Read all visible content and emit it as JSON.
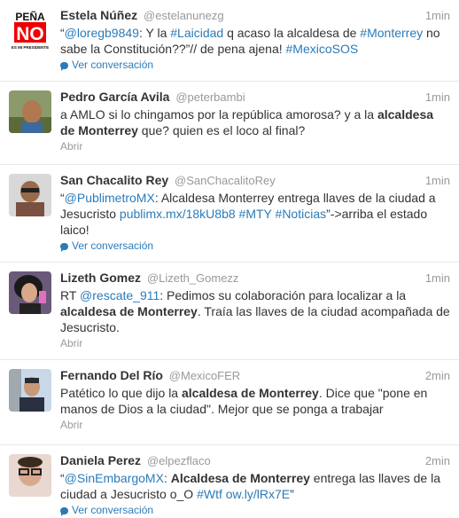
{
  "tweets": [
    {
      "fullname": "Estela Núñez",
      "username": "@estelanunezg",
      "time": "1min",
      "footer": "Ver conversación",
      "footer_type": "conversation",
      "avatar_icon": "pena-no-logo-avatar",
      "avatar_logo_text": [
        "PEÑA",
        "NO",
        "ES MI PRESIDENTE"
      ],
      "segments": [
        {
          "t": "“",
          "s": "text"
        },
        {
          "t": "@loregb9849",
          "s": "link"
        },
        {
          "t": ": Y la ",
          "s": "text"
        },
        {
          "t": "#Laicidad",
          "s": "link"
        },
        {
          "t": " q acaso la alcaldesa de ",
          "s": "text"
        },
        {
          "t": "#Monterrey",
          "s": "link"
        },
        {
          "t": " no sabe la Constitución??”// de pena ajena! ",
          "s": "text"
        },
        {
          "t": "#MexicoSOS",
          "s": "link"
        }
      ]
    },
    {
      "fullname": "Pedro García Avila",
      "username": "@peterbambi",
      "time": "1min",
      "footer": "Abrir",
      "footer_type": "open",
      "avatar_icon": "user-photo-avatar",
      "segments": [
        {
          "t": "a AMLO si lo chingamos por la república amorosa? y a la ",
          "s": "text"
        },
        {
          "t": "alcaldesa de Monterrey",
          "s": "bold"
        },
        {
          "t": " que? quien es el loco al final?",
          "s": "text"
        }
      ]
    },
    {
      "fullname": "San Chacalito Rey",
      "username": "@SanChacalitoRey",
      "time": "1min",
      "footer": "Ver conversación",
      "footer_type": "conversation",
      "avatar_icon": "user-photo-avatar",
      "segments": [
        {
          "t": "“",
          "s": "text"
        },
        {
          "t": "@PublimetroMX",
          "s": "link"
        },
        {
          "t": ": Alcaldesa Monterrey entrega llaves de la ciudad a Jesucristo ",
          "s": "text"
        },
        {
          "t": "publimx.mx/18kU8b8",
          "s": "link"
        },
        {
          "t": " ",
          "s": "text"
        },
        {
          "t": "#MTY",
          "s": "link"
        },
        {
          "t": " ",
          "s": "text"
        },
        {
          "t": "#Noticias",
          "s": "link"
        },
        {
          "t": "”->arriba el estado laico!",
          "s": "text"
        }
      ]
    },
    {
      "fullname": "Lizeth Gomez",
      "username": "@Lizeth_Gomezz",
      "time": "1min",
      "footer": "Abrir",
      "footer_type": "open",
      "avatar_icon": "user-photo-avatar",
      "segments": [
        {
          "t": "RT ",
          "s": "text"
        },
        {
          "t": "@rescate_911",
          "s": "link"
        },
        {
          "t": ": Pedimos su colaboración para localizar a la ",
          "s": "text"
        },
        {
          "t": "alcaldesa de Monterrey",
          "s": "bold"
        },
        {
          "t": ". Traía las llaves de la ciudad acompañada de Jesucristo.",
          "s": "text"
        }
      ]
    },
    {
      "fullname": "Fernando Del Río",
      "username": "@MexicoFER",
      "time": "2min",
      "footer": "Abrir",
      "footer_type": "open",
      "avatar_icon": "user-photo-avatar",
      "segments": [
        {
          "t": "Patético lo que dijo la ",
          "s": "text"
        },
        {
          "t": "alcaldesa de Monterrey",
          "s": "bold"
        },
        {
          "t": ". Dice que \"pone en manos de Dios a la ciudad\". Mejor que se ponga a trabajar",
          "s": "text"
        }
      ]
    },
    {
      "fullname": "Daniela Perez",
      "username": "@elpezflaco",
      "time": "2min",
      "footer": "Ver conversación",
      "footer_type": "conversation",
      "avatar_icon": "user-photo-avatar",
      "segments": [
        {
          "t": "“",
          "s": "text"
        },
        {
          "t": "@SinEmbargoMX",
          "s": "link"
        },
        {
          "t": ": ",
          "s": "text"
        },
        {
          "t": "Alcaldesa de Monterrey",
          "s": "bold"
        },
        {
          "t": " entrega las llaves de la ciudad a Jesucristo o_O ",
          "s": "text"
        },
        {
          "t": "#Wtf",
          "s": "link"
        },
        {
          "t": "  ",
          "s": "text"
        },
        {
          "t": "ow.ly/lRx7E",
          "s": "link"
        },
        {
          "t": "”",
          "s": "text"
        }
      ]
    }
  ]
}
